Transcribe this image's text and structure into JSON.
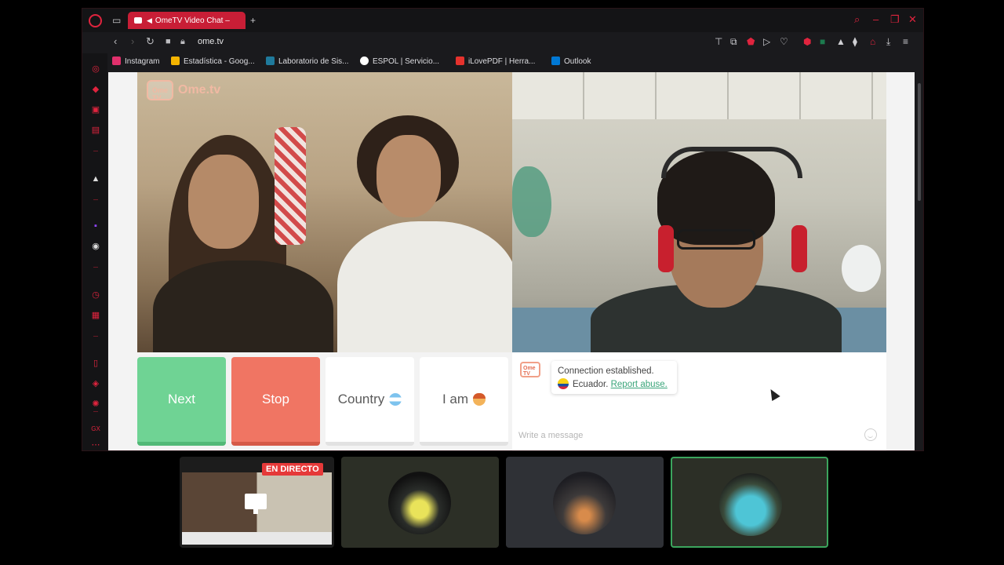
{
  "browser": {
    "tab_title": "OmeTV Video Chat –",
    "url": "ome.tv",
    "bookmarks": [
      {
        "label": "Instagram",
        "color": "#e1306c"
      },
      {
        "label": "Estadística - Goog...",
        "color": "#f4b400"
      },
      {
        "label": "Laboratorio de Sis...",
        "color": "#1f7a9c"
      },
      {
        "label": "ESPOL | Servicio...",
        "color": "#ffffff"
      },
      {
        "label": "iLovePDF | Herra...",
        "color": "#e5322d"
      },
      {
        "label": "Outlook",
        "color": "#0078d4"
      }
    ]
  },
  "ometv": {
    "brand": "Ome.tv",
    "logo_badge": "Ome TV",
    "buttons": {
      "next": "Next",
      "stop": "Stop",
      "country": "Country",
      "iam": "I am"
    },
    "chat": {
      "status": "Connection established.",
      "country": "Ecuador.",
      "report": "Report abuse.",
      "placeholder": "Write a message"
    },
    "colors": {
      "next": "#6fd394",
      "stop": "#f07563",
      "link": "#3aa57a"
    }
  },
  "stream": {
    "live_badge": "EN DIRECTO"
  }
}
